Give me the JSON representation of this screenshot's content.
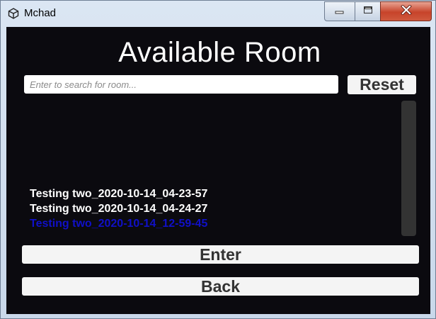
{
  "window": {
    "title": "Mchad",
    "icon": "unity-logo-icon"
  },
  "titlebar_controls": [
    "minimize-icon",
    "maximize-icon",
    "close-icon"
  ],
  "main": {
    "title": "Available Room",
    "search": {
      "placeholder": "Enter to search for room...",
      "value": ""
    },
    "reset_label": "Reset",
    "rooms": [
      {
        "name": "Testing two_2020-10-14_04-23-57",
        "selected": false
      },
      {
        "name": "Testing two_2020-10-14_04-24-27",
        "selected": false
      },
      {
        "name": "Testing two_2020-10-14_12-59-45",
        "selected": true
      }
    ],
    "enter_label": "Enter",
    "back_label": "Back"
  },
  "colors": {
    "background": "#0b0a0f",
    "selected_room": "#1010c8",
    "button_bg": "#f4f4f4",
    "button_text": "#333333"
  }
}
